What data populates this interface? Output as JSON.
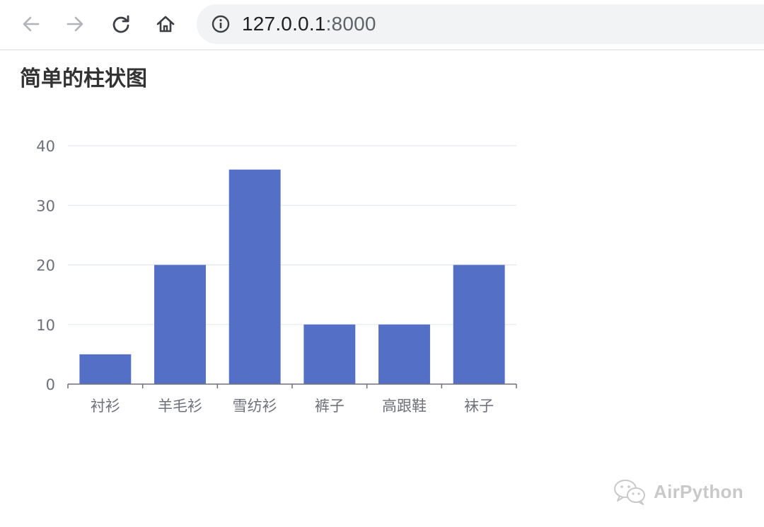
{
  "browser": {
    "url_host": "127.0.0.1",
    "url_port": ":8000",
    "icons": {
      "back": "arrow-left-icon",
      "forward": "arrow-right-icon",
      "reload": "reload-icon",
      "home": "home-icon",
      "info": "info-icon"
    }
  },
  "page": {
    "title": "简单的柱状图"
  },
  "chart_data": {
    "type": "bar",
    "title": "",
    "xlabel": "",
    "ylabel": "",
    "categories": [
      "衬衫",
      "羊毛衫",
      "雪纺衫",
      "裤子",
      "高跟鞋",
      "袜子"
    ],
    "values": [
      5,
      20,
      36,
      10,
      10,
      20
    ],
    "ylim": [
      0,
      40
    ],
    "yticks": [
      0,
      10,
      20,
      30,
      40
    ],
    "grid": true,
    "bar_color": "#5470c6",
    "axis_color": "#6e7079",
    "grid_color": "#e0e6f1"
  },
  "watermark": {
    "text": "AirPython",
    "icon": "wechat-icon"
  }
}
